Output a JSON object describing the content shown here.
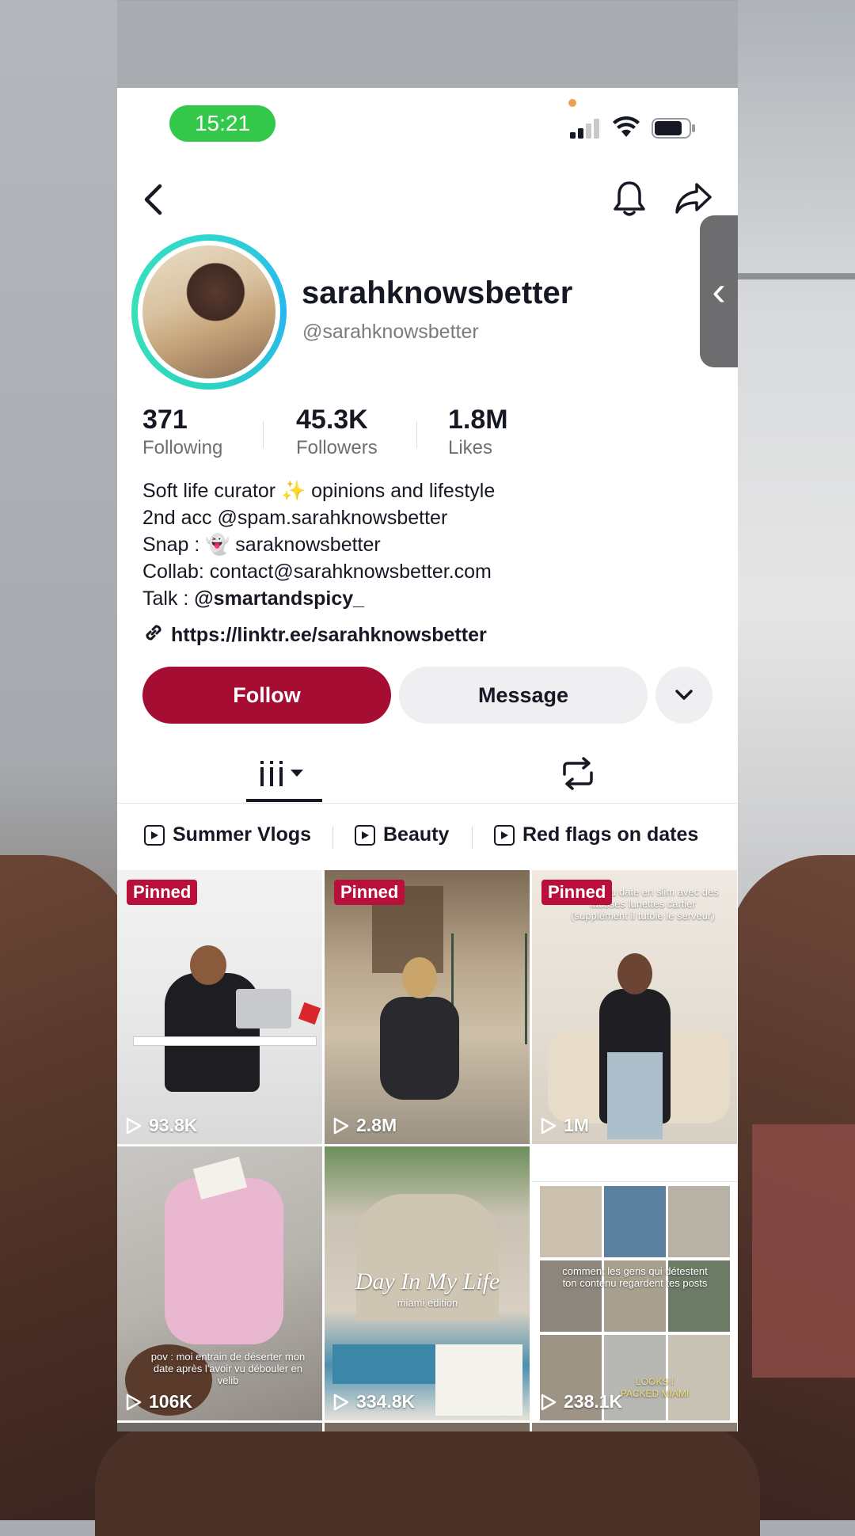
{
  "status": {
    "time": "15:21"
  },
  "profile": {
    "display_name": "sarahknowsbetter",
    "handle": "@sarahknowsbetter"
  },
  "stats": [
    {
      "value": "371",
      "label": "Following"
    },
    {
      "value": "45.3K",
      "label": "Followers"
    },
    {
      "value": "1.8M",
      "label": "Likes"
    }
  ],
  "bio": {
    "line1": "Soft life curator ✨ opinions and lifestyle",
    "line2": "2nd acc @spam.sarahknowsbetter",
    "line3": "Snap : 👻 saraknowsbetter",
    "line4": "Collab: contact@sarahknowsbetter.com",
    "line5_prefix": "Talk : ",
    "line5_mention": "@smartandspicy_",
    "link": "https://linktr.ee/sarahknowsbetter"
  },
  "actions": {
    "follow": "Follow",
    "message": "Message"
  },
  "playlists": [
    "Summer Vlogs",
    "Beauty",
    "Red flags on dates"
  ],
  "videos": [
    {
      "pinned": "Pinned",
      "views": "93.8K"
    },
    {
      "pinned": "Pinned",
      "views": "2.8M"
    },
    {
      "pinned": "Pinned",
      "views": "1M",
      "caption": "marque au date en slim avec des fausses lunettes cartier (supplément il tutoie le serveur)"
    },
    {
      "views": "106K",
      "caption": "pov : moi entrain de déserter mon date après l'avoir vu débouler en velib"
    },
    {
      "views": "334.8K",
      "caption": "Day In My Life",
      "subcaption": "miami edition"
    },
    {
      "views": "238.1K",
      "caption": "comment les gens qui détestent ton contenu regardent tes posts",
      "subcaption": "LOOKS I PACKED MIAMI"
    }
  ],
  "colors": {
    "follow": "#a50d33",
    "pinned": "#b8103a",
    "time_pill": "#34c84a",
    "ring": "#2fd6d0"
  }
}
